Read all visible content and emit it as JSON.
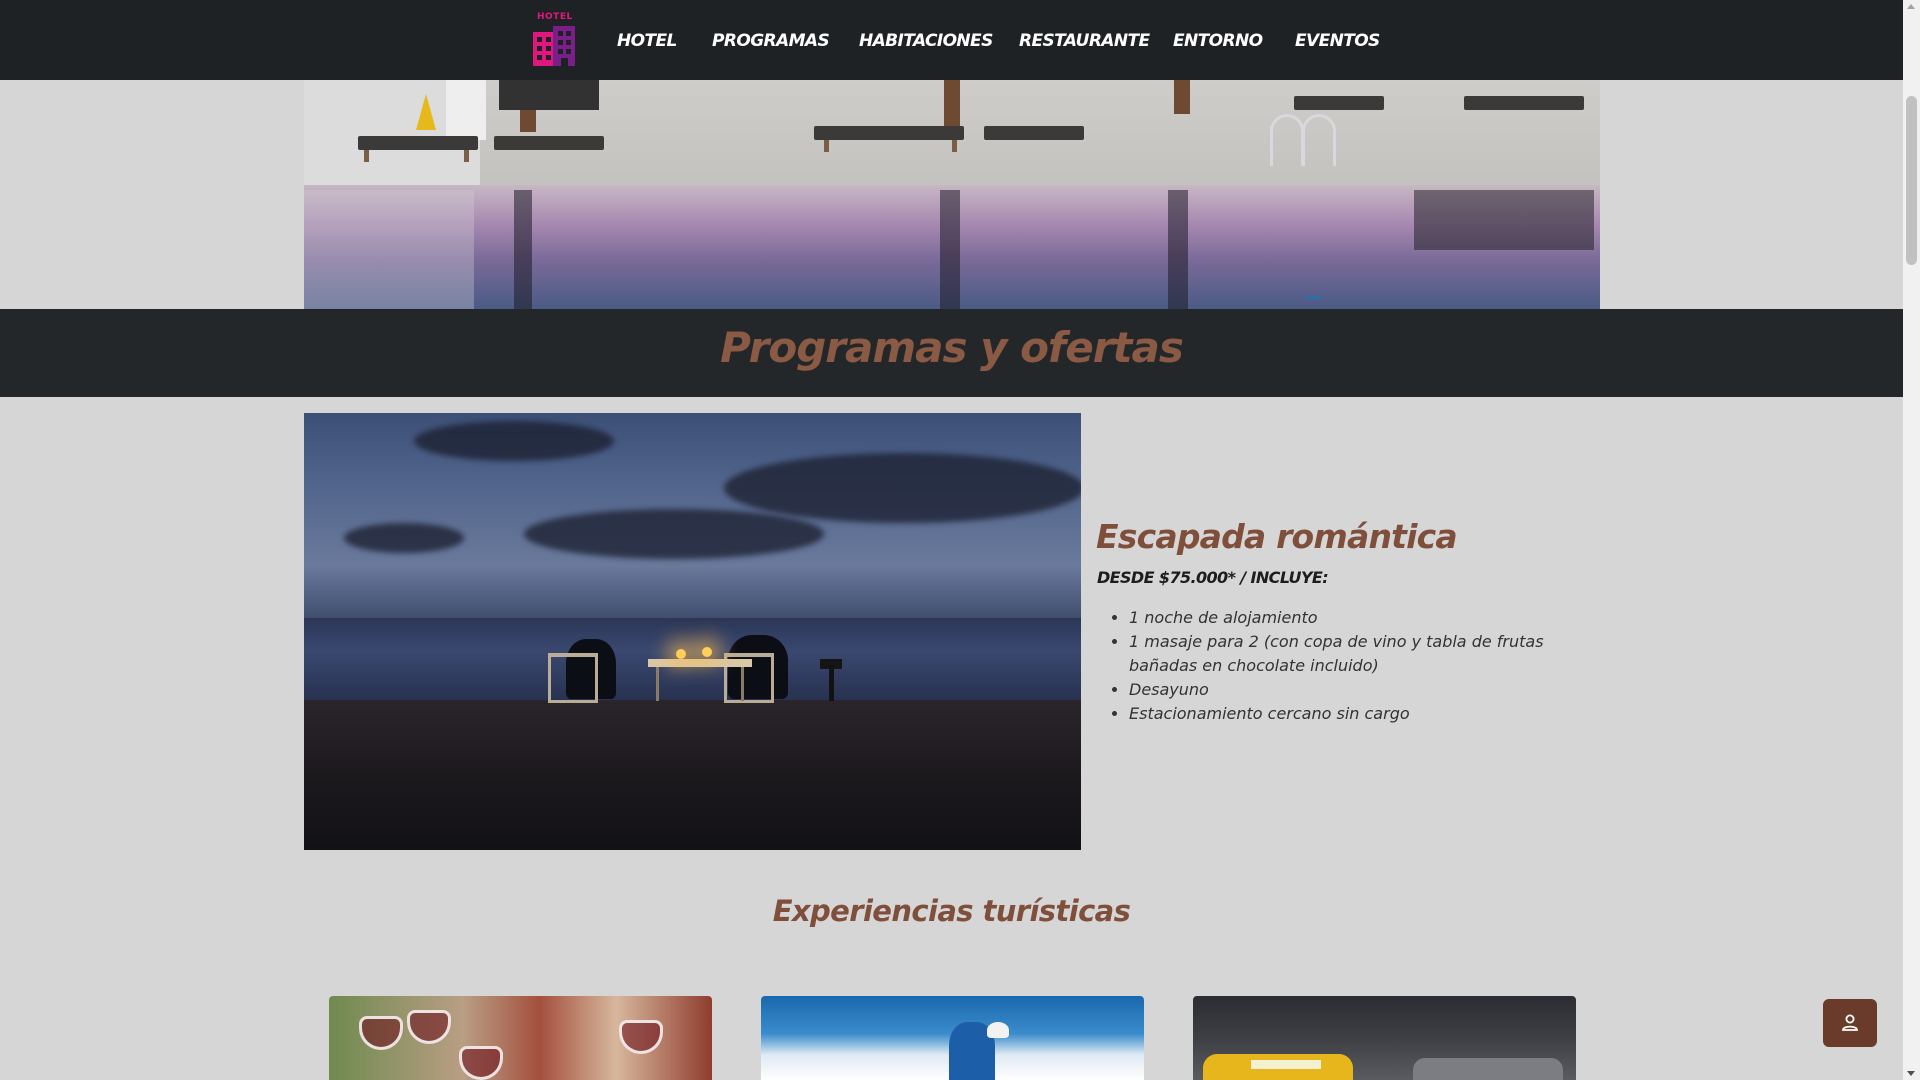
{
  "nav": {
    "logo_text": "HOTEL",
    "items": [
      {
        "label": "HOTEL"
      },
      {
        "label": "PROGRAMAS"
      },
      {
        "label": "HABITACIONES"
      },
      {
        "label": "RESTAURANTE"
      },
      {
        "label": "ENTORNO"
      },
      {
        "label": "EVENTOS"
      }
    ]
  },
  "section": {
    "title": "Programas y ofertas"
  },
  "offer": {
    "title": "Escapada romántica",
    "price": "DESDE $75.000* / INCLUYE:",
    "items": [
      "1 noche de alojamiento",
      "1 masaje para 2 (con copa de vino y tabla de frutas bañadas en chocolate incluido)",
      "Desayuno",
      "Estacionamiento cercano sin cargo"
    ]
  },
  "experiences": {
    "title": "Experiencias turísticas"
  },
  "icons": {
    "logo": "hotel-building-icon",
    "float_button": "user-icon"
  },
  "colors": {
    "navbar_bg": "#1f2225",
    "accent_title": "#8a5a44",
    "logo_pink": "#e0177d",
    "float_button_bg": "#6a3a2a",
    "page_bg": "#d6d6d6"
  }
}
